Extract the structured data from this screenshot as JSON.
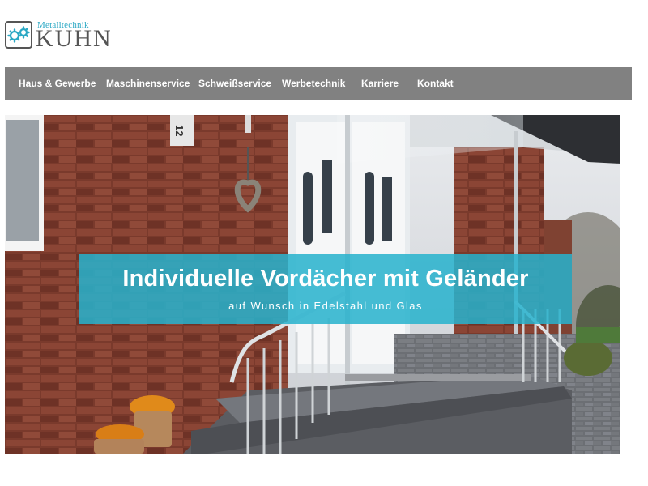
{
  "logo": {
    "small_text": "Metalltechnik",
    "big_text": "KUHN",
    "icon": "gears-icon",
    "accent_color": "#2aa8c4"
  },
  "nav": {
    "items": [
      {
        "label": "Haus & Gewerbe"
      },
      {
        "label": "Maschinenservice"
      },
      {
        "label": "Schweißservice"
      },
      {
        "label": "Werbetechnik"
      },
      {
        "label": "Karriere"
      },
      {
        "label": "Kontakt"
      }
    ],
    "background_color": "#818181"
  },
  "hero": {
    "title": "Individuelle Vordächer mit Geländer",
    "subtitle": "auf Wunsch in Edelstahl und Glas",
    "house_number": "12",
    "banner_color": "#28b2cd"
  }
}
